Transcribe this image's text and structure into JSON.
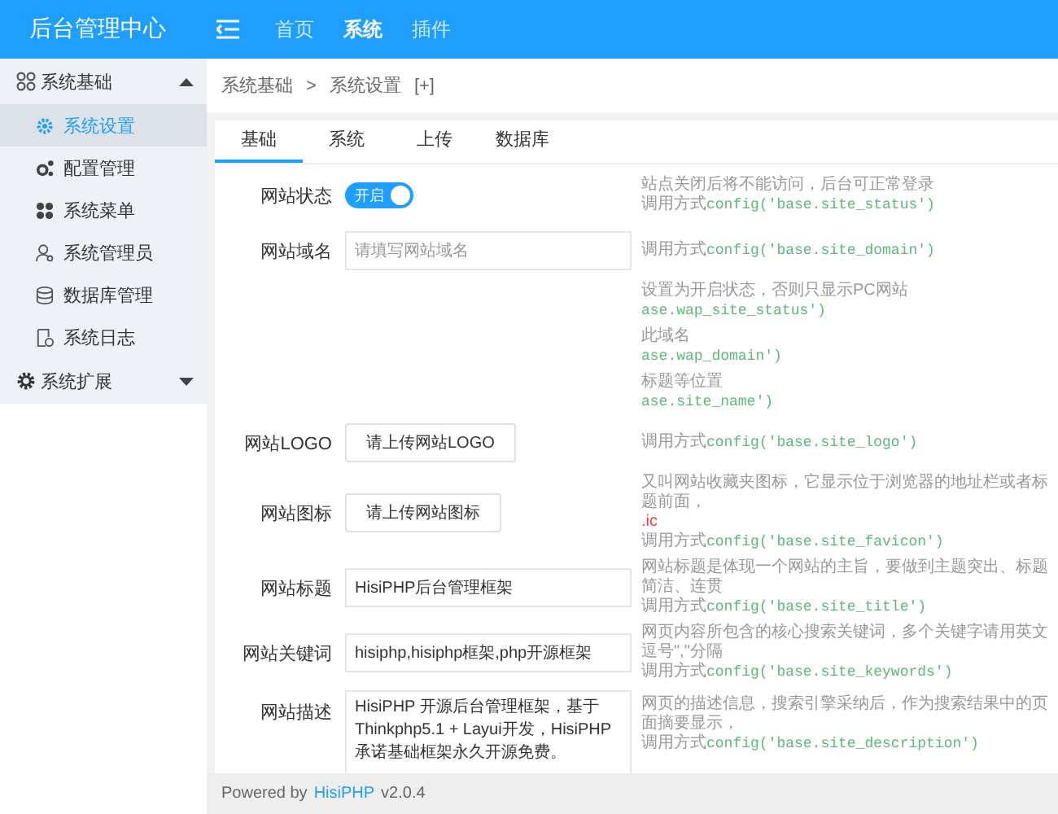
{
  "header": {
    "title": "后台管理中心",
    "nav": [
      {
        "label": "首页",
        "selected": false
      },
      {
        "label": "系统",
        "selected": true
      },
      {
        "label": "插件",
        "selected": false
      }
    ]
  },
  "sidebar": {
    "groups": [
      {
        "label": "系统基础",
        "expanded": true,
        "items": [
          {
            "label": "系统设置",
            "selected": true
          },
          {
            "label": "配置管理",
            "selected": false
          },
          {
            "label": "系统菜单",
            "selected": false
          },
          {
            "label": "系统管理员",
            "selected": false
          },
          {
            "label": "数据库管理",
            "selected": false
          },
          {
            "label": "系统日志",
            "selected": false
          }
        ]
      },
      {
        "label": "系统扩展",
        "expanded": false
      }
    ]
  },
  "breadcrumb": {
    "items": [
      "系统基础",
      "系统设置"
    ],
    "separator": ">",
    "action": "[+]"
  },
  "tabs": [
    {
      "label": "基础",
      "selected": true
    },
    {
      "label": "系统",
      "selected": false
    },
    {
      "label": "上传",
      "selected": false
    },
    {
      "label": "数据库",
      "selected": false
    }
  ],
  "form": [
    {
      "kind": "switch",
      "label": "网站状态",
      "on": true,
      "text": "开启",
      "note": "站点关闭后将不能访问，后台可正常登录",
      "call": "调用方式",
      "code": "config('base.site_status')"
    },
    {
      "kind": "input",
      "label": "网站域名",
      "placeholder": "请填写网站域名",
      "call": "调用方式",
      "code": "config('base.site_domain')"
    },
    {
      "kind": "none",
      "note": "设置为开启状态，否则只显示PC网站",
      "code": "ase.wap_site_status')"
    },
    {
      "kind": "none",
      "note": "此域名",
      "code": "ase.wap_domain')"
    },
    {
      "kind": "none",
      "note": "标题等位置",
      "code": "ase.site_name')"
    },
    {
      "kind": "upload",
      "label": "网站LOGO",
      "text": "请上传网站LOGO",
      "call": "调用方式",
      "code": "config('base.site_logo')"
    },
    {
      "kind": "upload",
      "label": "网站图标",
      "text": "请上传网站图标",
      "note": "又叫网站收藏夹图标，它显示位于浏览器的地址栏或者标题前面，",
      "alert": ".ic",
      "call": "调用方式",
      "code": "config('base.site_favicon')"
    },
    {
      "kind": "input",
      "label": "网站标题",
      "value": "HisiPHP后台管理框架",
      "note": "网站标题是体现一个网站的主旨，要做到主题突出、标题简洁、连贯",
      "call": "调用方式",
      "code": "config('base.site_title')"
    },
    {
      "kind": "input",
      "label": "网站关键词",
      "value": "hisiphp,hisiphp框架,php开源框架",
      "note": "网页内容所包含的核心搜索关键词，多个关键字请用英文逗号\",\"分隔",
      "call": "调用方式",
      "code": "config('base.site_keywords')"
    },
    {
      "kind": "textarea",
      "label": "网站描述",
      "value": "HisiPHP 开源后台管理框架，基于Thinkphp5.1 + Layui开发，HisiPHP承诺基础框架永久开源免费。",
      "note": "网页的描述信息，搜索引擎采纳后，作为搜索结果中的页面摘要显示，",
      "call": "调用方式",
      "code": "config('base.site_description')"
    }
  ],
  "footer": {
    "text": "Powered by",
    "link": "HisiPHP",
    "version": "v2.0.4"
  }
}
